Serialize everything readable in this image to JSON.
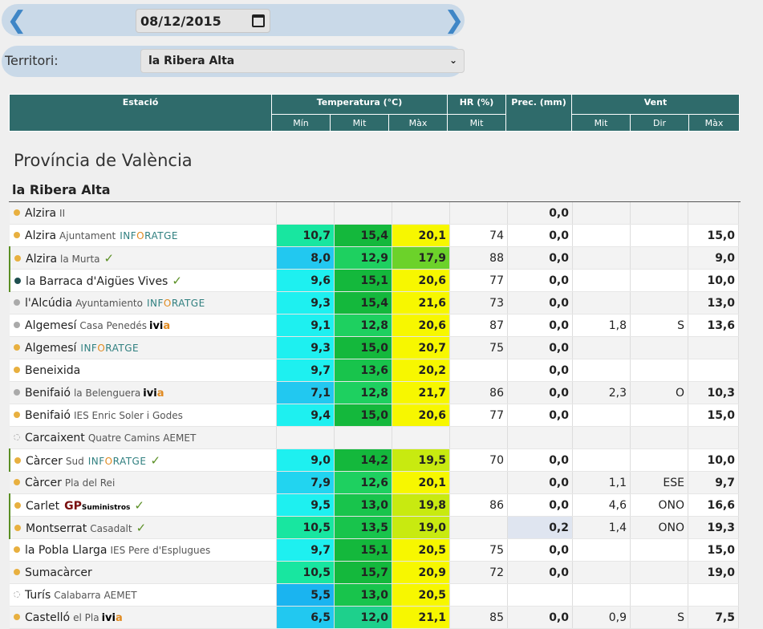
{
  "date": {
    "value": "08/12/2015",
    "prev_icon": "chevron-left-icon",
    "next_icon": "chevron-right-icon"
  },
  "territory": {
    "label": "Territori:",
    "selected": "la Ribera Alta"
  },
  "header": {
    "station": "Estació",
    "temperature": "Temperatura (°C)",
    "hr": "HR (%)",
    "prec": "Prec. (mm)",
    "wind": "Vent",
    "min": "Mín",
    "mit": "Mit",
    "max": "Màx",
    "hr_mit": "Mit",
    "wind_mit": "Mit",
    "wind_dir": "Dir",
    "wind_max": "Màx"
  },
  "province": "Província de València",
  "comarca": "la Ribera Alta",
  "rows": [
    {
      "dot": "orange",
      "name": "Alzira",
      "sub": "II",
      "logo": "",
      "check": false,
      "min": "",
      "mit": "",
      "max": "",
      "hr": "",
      "prec": "0,0",
      "wmit": "",
      "wdir": "",
      "wmax": "",
      "minc": "",
      "mitc": "",
      "maxc": ""
    },
    {
      "dot": "orange",
      "name": "Alzira",
      "sub": "Ajuntament",
      "logo": "info",
      "check": false,
      "min": "10,7",
      "mit": "15,4",
      "max": "20,1",
      "hr": "74",
      "prec": "0,0",
      "wmit": "",
      "wdir": "",
      "wmax": "15,0",
      "minc": "#18e6a0",
      "mitc": "#14b83c",
      "maxc": "#f7f700"
    },
    {
      "dot": "orange",
      "name": "Alzira",
      "sub": "la Murta",
      "logo": "",
      "check": true,
      "min": "8,0",
      "mit": "12,9",
      "max": "17,9",
      "hr": "88",
      "prec": "0,0",
      "wmit": "",
      "wdir": "",
      "wmax": "9,0",
      "minc": "#22c8f0",
      "mitc": "#1ed060",
      "maxc": "#6cd22a"
    },
    {
      "dot": "dark",
      "name": "la Barraca d'Aigües Vives",
      "sub": "",
      "logo": "",
      "check": true,
      "min": "9,6",
      "mit": "15,1",
      "max": "20,6",
      "hr": "77",
      "prec": "0,0",
      "wmit": "",
      "wdir": "",
      "wmax": "10,0",
      "minc": "#1ef0f0",
      "mitc": "#14b83c",
      "maxc": "#f7f700"
    },
    {
      "dot": "gray",
      "name": "l'Alcúdia",
      "sub": "Ayuntamiento",
      "logo": "info",
      "check": false,
      "min": "9,3",
      "mit": "15,4",
      "max": "21,6",
      "hr": "73",
      "prec": "0,0",
      "wmit": "",
      "wdir": "",
      "wmax": "13,0",
      "minc": "#1ef0f0",
      "mitc": "#14b83c",
      "maxc": "#f7f700"
    },
    {
      "dot": "gray",
      "name": "Algemesí",
      "sub": "Casa Penedés",
      "logo": "ivia",
      "check": false,
      "min": "9,1",
      "mit": "12,8",
      "max": "20,6",
      "hr": "87",
      "prec": "0,0",
      "wmit": "1,8",
      "wdir": "S",
      "wmax": "13,6",
      "minc": "#1ef0f0",
      "mitc": "#1ed060",
      "maxc": "#f7f700"
    },
    {
      "dot": "orange",
      "name": "Algemesí",
      "sub": "",
      "logo": "info",
      "check": false,
      "min": "9,3",
      "mit": "15,0",
      "max": "20,7",
      "hr": "75",
      "prec": "0,0",
      "wmit": "",
      "wdir": "",
      "wmax": "",
      "minc": "#1ef0f0",
      "mitc": "#14b83c",
      "maxc": "#f7f700"
    },
    {
      "dot": "orange",
      "name": "Beneixida",
      "sub": "",
      "logo": "",
      "check": false,
      "min": "9,7",
      "mit": "13,6",
      "max": "20,2",
      "hr": "",
      "prec": "0,0",
      "wmit": "",
      "wdir": "",
      "wmax": "",
      "minc": "#1ef0f0",
      "mitc": "#18c44c",
      "maxc": "#f7f700"
    },
    {
      "dot": "gray",
      "name": "Benifaió",
      "sub": "la Belenguera",
      "logo": "ivia",
      "check": false,
      "min": "7,1",
      "mit": "12,8",
      "max": "21,7",
      "hr": "86",
      "prec": "0,0",
      "wmit": "2,3",
      "wdir": "O",
      "wmax": "10,3",
      "minc": "#22c8f0",
      "mitc": "#1ed060",
      "maxc": "#f7f700"
    },
    {
      "dot": "orange",
      "name": "Benifaió",
      "sub": "IES Enric Soler i Godes",
      "logo": "",
      "check": false,
      "min": "9,4",
      "mit": "15,0",
      "max": "20,6",
      "hr": "77",
      "prec": "0,0",
      "wmit": "",
      "wdir": "",
      "wmax": "15,0",
      "minc": "#1ef0f0",
      "mitc": "#14b83c",
      "maxc": "#f7f700"
    },
    {
      "dot": "hollow",
      "name": "Carcaixent",
      "sub": "Quatre Camins AEMET",
      "logo": "",
      "check": false,
      "min": "",
      "mit": "",
      "max": "",
      "hr": "",
      "prec": "",
      "wmit": "",
      "wdir": "",
      "wmax": "",
      "minc": "",
      "mitc": "",
      "maxc": ""
    },
    {
      "dot": "orange",
      "name": "Càrcer",
      "sub": "Sud",
      "logo": "info",
      "check": true,
      "min": "9,0",
      "mit": "14,2",
      "max": "19,5",
      "hr": "70",
      "prec": "0,0",
      "wmit": "",
      "wdir": "",
      "wmax": "10,0",
      "minc": "#1ef0f0",
      "mitc": "#14b83c",
      "maxc": "#c8ea10"
    },
    {
      "dot": "orange",
      "name": "Càrcer",
      "sub": "Pla del Rei",
      "logo": "",
      "check": false,
      "min": "7,9",
      "mit": "12,6",
      "max": "20,1",
      "hr": "",
      "prec": "0,0",
      "wmit": "1,1",
      "wdir": "ESE",
      "wmax": "9,7",
      "minc": "#22d4f0",
      "mitc": "#1ed060",
      "maxc": "#f7f700"
    },
    {
      "dot": "orange",
      "name": "Carlet",
      "sub": "",
      "logo": "gp",
      "check": true,
      "min": "9,5",
      "mit": "13,0",
      "max": "19,8",
      "hr": "86",
      "prec": "0,0",
      "wmit": "4,6",
      "wdir": "ONO",
      "wmax": "16,6",
      "minc": "#1ef0f0",
      "mitc": "#18c44c",
      "maxc": "#c8ea10"
    },
    {
      "dot": "orange",
      "name": "Montserrat",
      "sub": "Casadalt",
      "logo": "",
      "check": true,
      "min": "10,5",
      "mit": "13,5",
      "max": "19,0",
      "hr": "",
      "prec": "0,2",
      "wmit": "1,4",
      "wdir": "ONO",
      "wmax": "19,3",
      "minc": "#18e6a0",
      "mitc": "#18c44c",
      "maxc": "#c8ea10",
      "prechl": true
    },
    {
      "dot": "orange",
      "name": "la Pobla Llarga",
      "sub": "IES Pere d'Esplugues",
      "logo": "",
      "check": false,
      "min": "9,7",
      "mit": "15,1",
      "max": "20,5",
      "hr": "75",
      "prec": "0,0",
      "wmit": "",
      "wdir": "",
      "wmax": "15,0",
      "minc": "#1ef0f0",
      "mitc": "#14b83c",
      "maxc": "#f7f700"
    },
    {
      "dot": "orange",
      "name": "Sumacàrcer",
      "sub": "",
      "logo": "",
      "check": false,
      "min": "10,5",
      "mit": "15,7",
      "max": "20,9",
      "hr": "72",
      "prec": "0,0",
      "wmit": "",
      "wdir": "",
      "wmax": "19,0",
      "minc": "#18e6a0",
      "mitc": "#14b83c",
      "maxc": "#f7f700"
    },
    {
      "dot": "hollow",
      "name": "Turís",
      "sub": "Calabarra AEMET",
      "logo": "",
      "check": false,
      "min": "5,5",
      "mit": "13,0",
      "max": "20,5",
      "hr": "",
      "prec": "",
      "wmit": "",
      "wdir": "",
      "wmax": "",
      "minc": "#1ab4f0",
      "mitc": "#18c44c",
      "maxc": "#f7f700"
    },
    {
      "dot": "orange",
      "name": "Castelló",
      "sub": "el Pla",
      "logo": "ivia",
      "check": false,
      "min": "6,5",
      "mit": "12,0",
      "max": "21,1",
      "hr": "85",
      "prec": "0,0",
      "wmit": "0,9",
      "wdir": "S",
      "wmax": "7,5",
      "minc": "#22c8f0",
      "mitc": "#1ed08c",
      "maxc": "#f7f700"
    }
  ],
  "logos": {
    "info_a": "INF",
    "info_b": "O",
    "info_c": "RATGE",
    "ivia_a": "ivi",
    "ivia_b": "a",
    "gp": "GP",
    "gp_small": "Suministros"
  },
  "check_icon": "✓"
}
